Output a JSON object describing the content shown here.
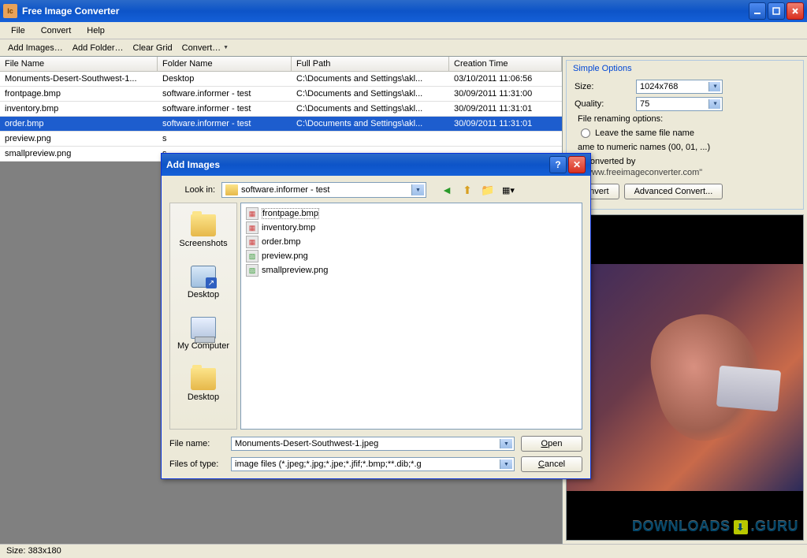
{
  "app": {
    "title": "Free Image Converter",
    "icon_label": "Ic"
  },
  "menu": {
    "file": "File",
    "convert": "Convert",
    "help": "Help"
  },
  "toolbar": {
    "add_images": "Add Images…",
    "add_folder": "Add Folder…",
    "clear_grid": "Clear Grid",
    "convert": "Convert…"
  },
  "grid": {
    "headers": {
      "file_name": "File Name",
      "folder_name": "Folder Name",
      "full_path": "Full Path",
      "creation_time": "Creation Time"
    },
    "rows": [
      {
        "file_name": "Monuments-Desert-Southwest-1...",
        "folder_name": "Desktop",
        "full_path": "C:\\Documents and Settings\\akl...",
        "creation_time": "03/10/2011 11:06:56",
        "selected": false
      },
      {
        "file_name": "frontpage.bmp",
        "folder_name": "software.informer - test",
        "full_path": "C:\\Documents and Settings\\akl...",
        "creation_time": "30/09/2011 11:31:00",
        "selected": false
      },
      {
        "file_name": "inventory.bmp",
        "folder_name": "software.informer - test",
        "full_path": "C:\\Documents and Settings\\akl...",
        "creation_time": "30/09/2011 11:31:01",
        "selected": false
      },
      {
        "file_name": "order.bmp",
        "folder_name": "software.informer - test",
        "full_path": "C:\\Documents and Settings\\akl...",
        "creation_time": "30/09/2011 11:31:01",
        "selected": true
      },
      {
        "file_name": "preview.png",
        "folder_name": "s",
        "full_path": "",
        "creation_time": "",
        "selected": false
      },
      {
        "file_name": "smallpreview.png",
        "folder_name": "s",
        "full_path": "",
        "creation_time": "",
        "selected": false
      }
    ]
  },
  "options": {
    "title": "Simple Options",
    "size_label": "Size:",
    "size_value": "1024x768",
    "quality_label": "Quality:",
    "quality_value": "75",
    "rename_label": "File renaming options:",
    "radio_same": "Leave the same file name",
    "radio_numeric": "ame to numeric names (00, 01, ...)",
    "convby_label": "\"Converted by",
    "convby_url": "www.freeimageconverter.com\"",
    "btn_convert": "onvert",
    "btn_advanced": "Advanced Convert..."
  },
  "watermark": {
    "text1": "DOWNLOADS",
    "text2": ".GURU"
  },
  "status": {
    "size": "Size: 383x180"
  },
  "dialog": {
    "title": "Add Images",
    "lookin_label": "Look in:",
    "lookin_value": "software.informer - test",
    "places": {
      "screenshots": "Screenshots",
      "desktop": "Desktop",
      "mycomputer": "My Computer",
      "desktop2": "Desktop"
    },
    "files": [
      {
        "name": "frontpage.bmp",
        "type": "bmp",
        "selected": true
      },
      {
        "name": "inventory.bmp",
        "type": "bmp",
        "selected": false
      },
      {
        "name": "order.bmp",
        "type": "bmp",
        "selected": false
      },
      {
        "name": "preview.png",
        "type": "png",
        "selected": false
      },
      {
        "name": "smallpreview.png",
        "type": "png",
        "selected": false
      }
    ],
    "filename_label": "File name:",
    "filename_value": "Monuments-Desert-Southwest-1.jpeg",
    "filetype_label": "Files of type:",
    "filetype_value": "image files (*.jpeg;*.jpg;*.jpe;*.jfif;*.bmp;**.dib;*.g",
    "open": "Open",
    "cancel": "Cancel"
  }
}
